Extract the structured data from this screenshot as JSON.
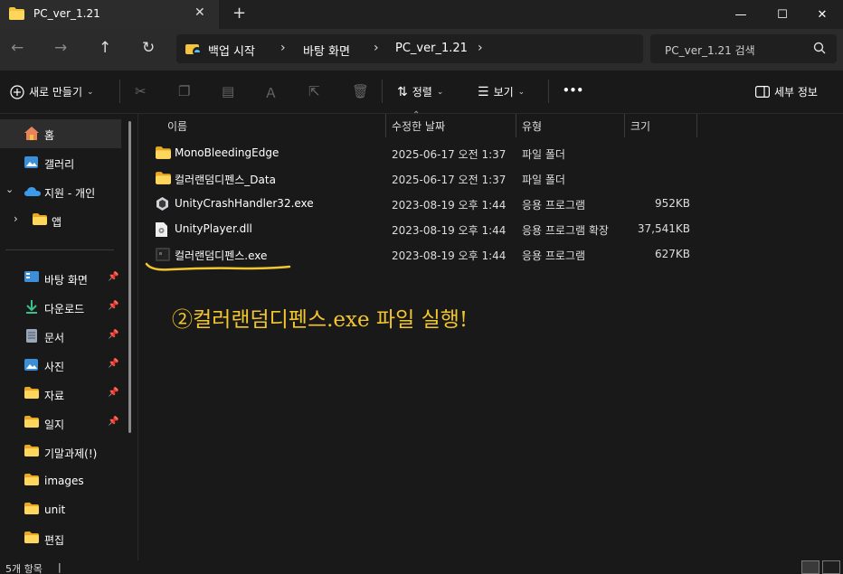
{
  "window": {
    "tab_title": "PC_ver_1.21",
    "tab_close": "✕",
    "new_tab": "+",
    "minimize": "—",
    "maximize": "☐",
    "close": "✕"
  },
  "nav": {
    "back": "←",
    "forward": "→",
    "up": "↑",
    "refresh": "↻",
    "breadcrumbs": [
      "백업 시작",
      "바탕 화면",
      "PC_ver_1.21"
    ],
    "separator": "›",
    "search_placeholder": "PC_ver_1.21 검색"
  },
  "toolbar": {
    "new_label": "새로 만들기",
    "sort_label": "정렬",
    "view_label": "보기",
    "more_label": "•••",
    "details_label": "세부 정보"
  },
  "sidebar": {
    "items": [
      {
        "label": "홈",
        "icon": "home-icon",
        "pinned": false
      },
      {
        "label": "갤러리",
        "icon": "gallery-icon",
        "pinned": false
      },
      {
        "label": "지원 - 개인",
        "icon": "onedrive-icon",
        "pinned": false
      },
      {
        "label": "앱",
        "icon": "folder-icon",
        "pinned": false
      },
      {
        "label": "바탕 화면",
        "icon": "desktop-icon",
        "pinned": true
      },
      {
        "label": "다운로드",
        "icon": "download-icon",
        "pinned": true
      },
      {
        "label": "문서",
        "icon": "document-icon",
        "pinned": true
      },
      {
        "label": "사진",
        "icon": "pictures-icon",
        "pinned": true
      },
      {
        "label": "자료",
        "icon": "folder-icon",
        "pinned": true
      },
      {
        "label": "일지",
        "icon": "folder-icon",
        "pinned": true
      },
      {
        "label": "기말과제(!)",
        "icon": "folder-icon",
        "pinned": false
      },
      {
        "label": "images",
        "icon": "folder-icon",
        "pinned": false
      },
      {
        "label": "unit",
        "icon": "folder-icon",
        "pinned": false
      },
      {
        "label": "편집",
        "icon": "folder-icon",
        "pinned": false
      }
    ]
  },
  "columns": {
    "name": "이름",
    "date": "수정한 날짜",
    "type": "유형",
    "size": "크기"
  },
  "files": [
    {
      "name": "MonoBleedingEdge",
      "date": "2025-06-17 오전 1:37",
      "type": "파일 폴더",
      "size": "",
      "icon": "folder-icon"
    },
    {
      "name": "컬러랜덤디펜스_Data",
      "date": "2025-06-17 오전 1:37",
      "type": "파일 폴더",
      "size": "",
      "icon": "folder-icon"
    },
    {
      "name": "UnityCrashHandler32.exe",
      "date": "2023-08-19 오후 1:44",
      "type": "응용 프로그램",
      "size": "952KB",
      "icon": "unity-exe-icon"
    },
    {
      "name": "UnityPlayer.dll",
      "date": "2023-08-19 오후 1:44",
      "type": "응용 프로그램 확장",
      "size": "37,541KB",
      "icon": "dll-icon"
    },
    {
      "name": "컬러랜덤디펜스.exe",
      "date": "2023-08-19 오후 1:44",
      "type": "응용 프로그램",
      "size": "627KB",
      "icon": "game-exe-icon"
    }
  ],
  "annotation": {
    "text": "②컬러랜덤디펜스.exe 파일 실행!",
    "color": "#f2c62e"
  },
  "status": {
    "item_count": "5개 항목"
  }
}
